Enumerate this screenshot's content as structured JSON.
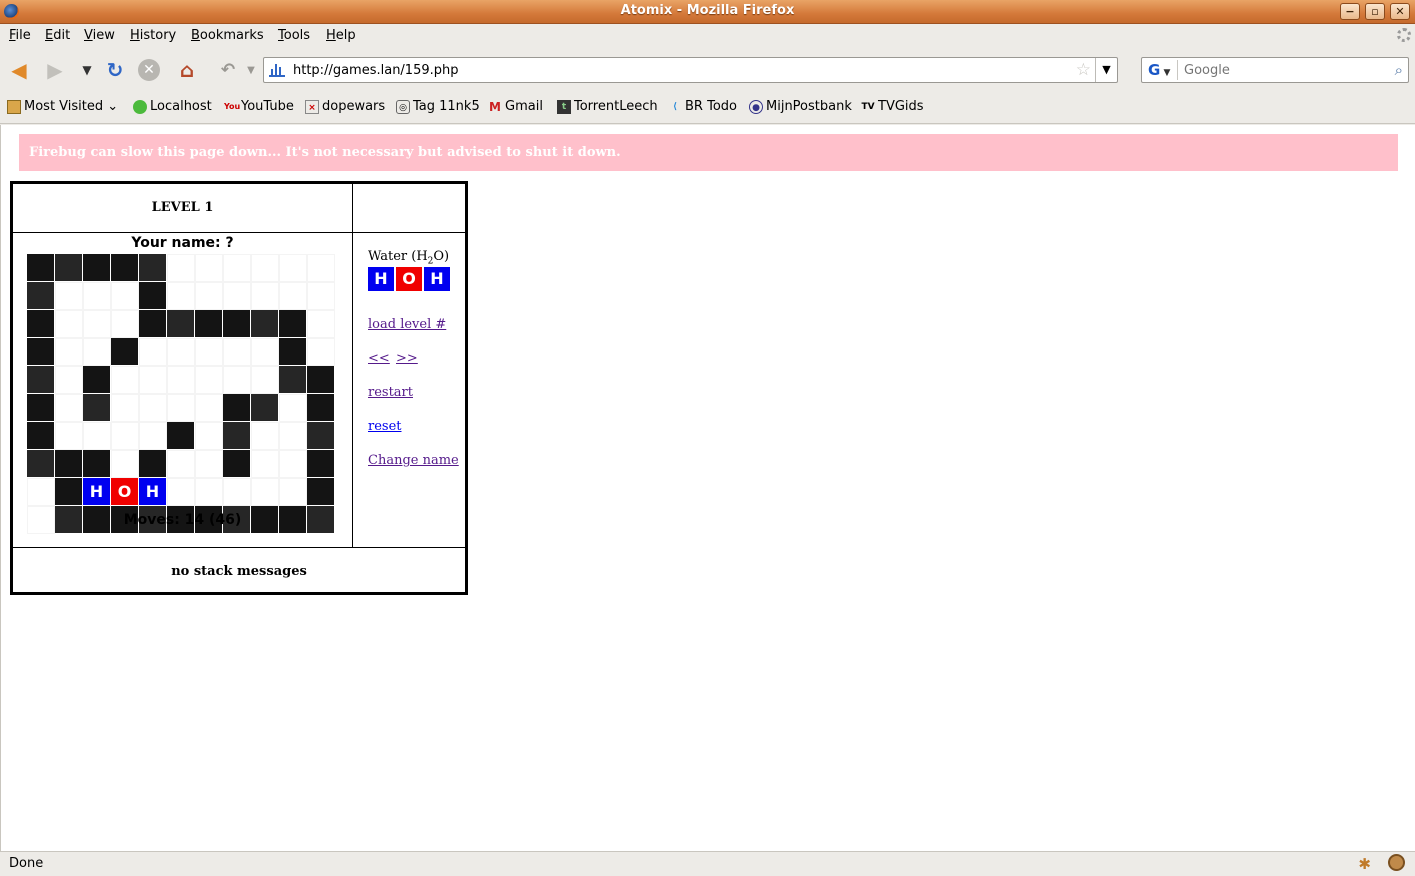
{
  "window": {
    "title": "Atomix - Mozilla Firefox",
    "buttons": {
      "minimize": "−",
      "maximize": "▫",
      "close": "✕"
    }
  },
  "menu": [
    "File",
    "Edit",
    "View",
    "History",
    "Bookmarks",
    "Tools",
    "Help"
  ],
  "nav": {
    "url": "http://games.lan/159.php",
    "search_placeholder": "Google",
    "search_engine": "G"
  },
  "bookmarks": [
    {
      "label": "Most Visited ⌄",
      "icon": "most-visited-icon"
    },
    {
      "label": "Localhost",
      "icon": "localhost-icon"
    },
    {
      "label": "YouTube",
      "icon": "youtube-icon"
    },
    {
      "label": "dopewars",
      "icon": "dopewars-icon"
    },
    {
      "label": "Tag 11nk5",
      "icon": "tag-icon"
    },
    {
      "label": "Gmail",
      "icon": "gmail-icon"
    },
    {
      "label": "TorrentLeech",
      "icon": "torrentleech-icon"
    },
    {
      "label": "BR Todo",
      "icon": "br-todo-icon"
    },
    {
      "label": "MijnPostbank",
      "icon": "postbank-icon"
    },
    {
      "label": "TVGids",
      "icon": "tvgids-icon"
    }
  ],
  "page": {
    "warning": "Firebug can slow this page down... It's not necessary but advised to shut it down.",
    "level": "LEVEL 1",
    "player": "Your name: ?",
    "moves": "Moves: 14 (46)",
    "stack": "no stack messages",
    "molecule": {
      "name_prefix": "Water (H",
      "name_sub": "2",
      "name_suffix": "O)",
      "atoms": [
        "H",
        "O",
        "H"
      ]
    },
    "links": {
      "load_level": "load level #",
      "prev": "<<",
      "next": ">>",
      "restart": "restart",
      "reset": "reset",
      "change_name": "Change name"
    },
    "board_rows": [
      "WWWWW......",
      "W...W......",
      "W...WWWWWW.",
      "W..W.....W.",
      "W.W......WW",
      "W.W....WW.W",
      "W....W.W..W",
      "WWW.W..W..W",
      ".WHOH.....W",
      ".WWWWWWWWWW"
    ]
  },
  "colors": {
    "wall_dark": "#141414",
    "wall_mid": "#262626",
    "atom_h": "#0000f0",
    "atom_o": "#f00000",
    "warning_bg": "#ffc0cb"
  },
  "status": "Done"
}
